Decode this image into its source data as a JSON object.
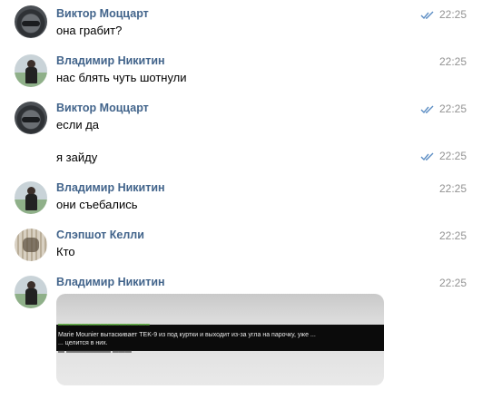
{
  "messages": [
    {
      "author": "Виктор Моццарт",
      "time": "22:25",
      "text": "она грабит?",
      "read_icon": "double-check-icon",
      "avatar_icon": "car-avatar"
    },
    {
      "author": "Владимир Никитин",
      "time": "22:25",
      "text": "нас блять чуть шотнули",
      "avatar_icon": "person-avatar"
    },
    {
      "author": "Виктор Моццарт",
      "time": "22:25",
      "text": "если да",
      "read_icon": "double-check-icon",
      "avatar_icon": "car-avatar"
    },
    {
      "time": "22:25",
      "text": "я зайду",
      "read_icon": "double-check-icon"
    },
    {
      "author": "Владимир Никитин",
      "time": "22:25",
      "text": "они съебались",
      "avatar_icon": "person-avatar"
    },
    {
      "author": "Слэпшот Келли",
      "time": "22:25",
      "text": "Кто",
      "avatar_icon": "person-avatar"
    },
    {
      "author": "Владимир Никитин",
      "time": "22:25",
      "avatar_icon": "person-avatar",
      "attachment": {
        "type": "screenshot",
        "lines": [
          "Marie Mounier вытаскивает TEK-9 из под куртки и выходит из-за угла на парочку, уже ...",
          "... целится в них."
        ]
      }
    }
  ],
  "colors": {
    "author": "#42648b",
    "time": "#939393",
    "check": "#5d8ec4"
  }
}
